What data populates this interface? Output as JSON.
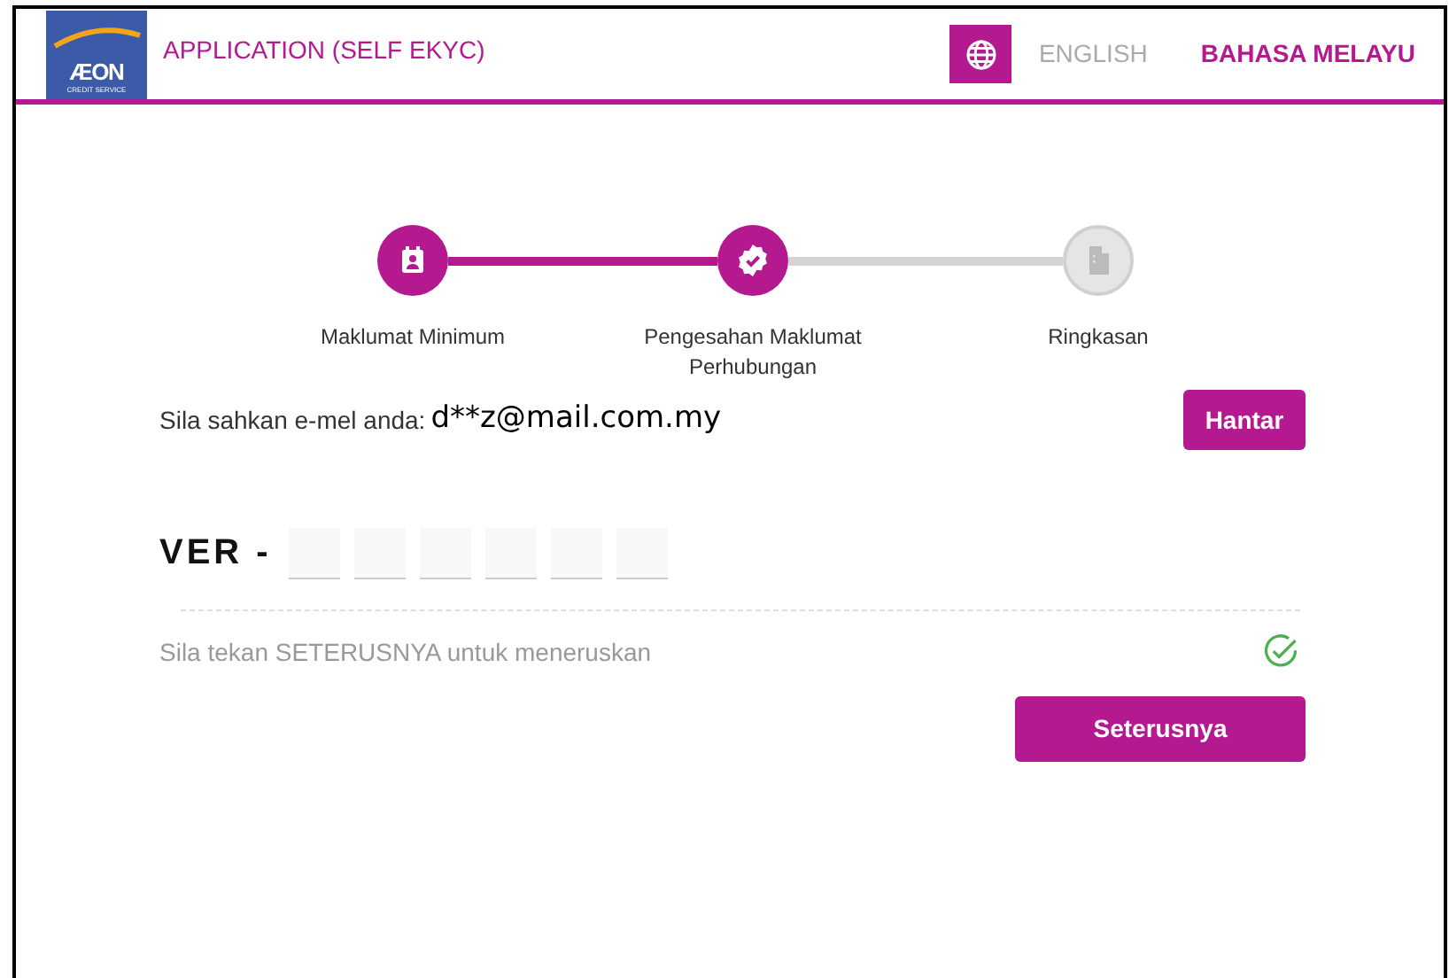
{
  "header": {
    "logo": {
      "brand": "ÆON",
      "tagline": "CREDIT SERVICE"
    },
    "title": "APPLICATION (SELF EKYC)",
    "languages": [
      {
        "label": "ENGLISH",
        "selected": false
      },
      {
        "label": "BAHASA MELAYU",
        "selected": true
      }
    ]
  },
  "steps": [
    {
      "label": "Maklumat Minimum",
      "completed": true
    },
    {
      "label": "Pengesahan Maklumat Perhubungan",
      "completed": true
    },
    {
      "label": "Ringkasan",
      "completed": false
    }
  ],
  "email": {
    "label": "Sila sahkan e-mel anda:",
    "value": "d**z@mail.com.my",
    "button": "Hantar"
  },
  "code": {
    "prefix": "VER -"
  },
  "hint": {
    "text": "Sila tekan SETERUSNYA untuk meneruskan",
    "verified": true
  },
  "next_button": "Seterusnya"
}
